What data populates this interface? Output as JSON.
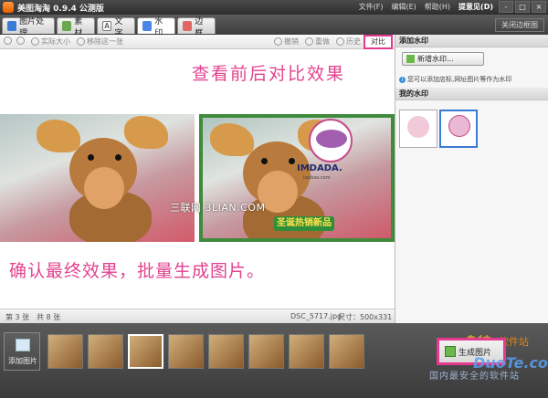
{
  "window": {
    "title": "美图淘淘 0.9.4 公测版",
    "menus": [
      "文件(F)",
      "编辑(E)",
      "帮助(H)",
      "提意见(D)"
    ],
    "controls": [
      "-",
      "□",
      "×"
    ]
  },
  "tabs": [
    {
      "label": "图片处理",
      "color": "#3a7bd5"
    },
    {
      "label": "素材",
      "color": "#6aa84f"
    },
    {
      "label": "文字",
      "color": "#e69138"
    },
    {
      "label": "水印",
      "color": "#4a86e8",
      "active": true
    },
    {
      "label": "边框",
      "color": "#e06666"
    }
  ],
  "close_panel_label": "关闭边框图",
  "toolbar": {
    "actual_size": "实际大小",
    "remove_one": "移除这一张",
    "undo": "撤销",
    "redo": "重做",
    "history": "历史",
    "compare": "对比"
  },
  "annotations": {
    "top": "查看前后对比效果",
    "bottom": "确认最终效果，批量生成图片。"
  },
  "watermark": {
    "brand": "IMDADA.",
    "brand_sub": "taobao.com",
    "promo": "圣诞热销新品",
    "site_overlay": "三联网 3LIAN.COM"
  },
  "status": {
    "index": "第 3 张",
    "total": "共 8 张",
    "filename": "DSC_5717.jpg",
    "size": "尺寸：500x331"
  },
  "right_panel": {
    "add_title": "添加水印",
    "new_button": "新增水印...",
    "tip": "您可以添加店标,网址图片等作为水印",
    "my_title": "我的水印"
  },
  "filmstrip": {
    "add_label": "添加图片",
    "thumbs": 9,
    "selected_index": 2,
    "generate_label": "生成图片"
  },
  "site_logo": {
    "line1": "多特",
    "line2": "软件站",
    "line3": "DuoTe.com",
    "footer": "国内最安全的软件站"
  }
}
